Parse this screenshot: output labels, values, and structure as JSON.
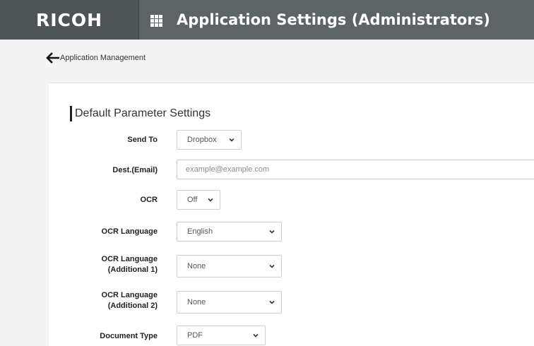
{
  "header": {
    "brand": "RICOH",
    "apps_icon": "apps-grid-icon",
    "title": "Application Settings (Administrators)"
  },
  "nav": {
    "back_label": "Application Management",
    "back_icon": "arrow-left-icon"
  },
  "section": {
    "title": "Default Parameter Settings"
  },
  "fields": {
    "send_to": {
      "label": "Send To",
      "value": "Dropbox"
    },
    "dest_email": {
      "label": "Dest.(Email)",
      "placeholder": "example@example.com"
    },
    "ocr": {
      "label": "OCR",
      "value": "Off"
    },
    "ocr_language": {
      "label": "OCR Language",
      "value": "English"
    },
    "ocr_language_add1": {
      "label_line1": "OCR Language",
      "label_line2": "(Additional 1)",
      "value": "None"
    },
    "ocr_language_add2": {
      "label_line1": "OCR Language",
      "label_line2": "(Additional 2)",
      "value": "None"
    },
    "document_type": {
      "label": "Document Type",
      "value": "PDF"
    }
  },
  "colors": {
    "header_bg": "#5d6465",
    "brand_bg": "#4e5556",
    "page_bg": "#f4f4f4",
    "panel_bg": "#ffffff"
  }
}
